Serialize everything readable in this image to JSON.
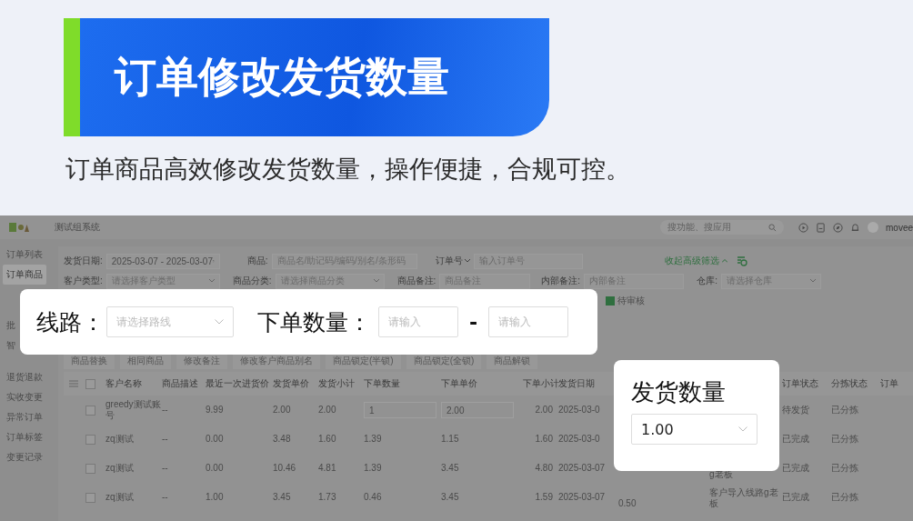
{
  "banner": {
    "title": "订单修改发货数量",
    "subtitle": "订单商品高效修改发货数量，操作便捷，合规可控。"
  },
  "app": {
    "system_name": "测试组系统",
    "search": {
      "placeholder": "搜功能、搜应用"
    },
    "user": "movee",
    "sidebar": {
      "items": [
        {
          "label": "订单列表",
          "selected": false
        },
        {
          "label": "订单商品",
          "selected": true
        },
        {
          "label": "批",
          "selected": false
        },
        {
          "label": "智",
          "selected": false
        },
        {
          "label": "退货退款",
          "selected": false
        },
        {
          "label": "实收变更",
          "selected": false
        },
        {
          "label": "异常订单",
          "selected": false
        },
        {
          "label": "订单标签",
          "selected": false
        },
        {
          "label": "变更记录",
          "selected": false
        }
      ]
    },
    "filters": {
      "row_1": [
        {
          "label": "发货日期:",
          "value": "2025-03-07 - 2025-03-07",
          "kind": "date"
        },
        {
          "label": "商品:",
          "placeholder": "商品名/助记码/编码/别名/条形码",
          "kind": "text"
        },
        {
          "label": "订单号",
          "placeholder": "输入订单号",
          "kind": "dropdown-label"
        }
      ],
      "collapse_link": "收起高级筛选",
      "row_2": [
        {
          "label": "客户类型:",
          "placeholder": "请选择客户类型",
          "kind": "select"
        },
        {
          "label": "商品分类:",
          "placeholder": "请选择商品分类",
          "kind": "select"
        },
        {
          "label": "商品备注:",
          "placeholder": "商品备注",
          "kind": "text"
        },
        {
          "label": "内部备注:",
          "placeholder": "内部备注",
          "kind": "text"
        },
        {
          "label": "仓库:",
          "placeholder": "请选择仓库",
          "kind": "select"
        }
      ],
      "pending_review": {
        "label": "待审核",
        "checked": true
      }
    },
    "actions": [
      "商品替换",
      "相同商品",
      "修改备注",
      "修改客户商品别名",
      "商品锁定(半锁)",
      "商品锁定(全锁)",
      "商品解锁"
    ],
    "table": {
      "all_checked": false,
      "columns": [
        "客户名称",
        "商品描述",
        "最近一次进货价",
        "发货单价",
        "发货小计",
        "下单数量",
        "下单单价",
        "下单小计",
        "发货日期",
        null,
        null,
        "订单状态",
        "分拣状态",
        "订单"
      ],
      "rows": [
        {
          "checked": false,
          "editable": true,
          "cells": [
            "greedy测试账号",
            "--",
            "9.99",
            "2.00",
            "2.00",
            "1",
            "2.00",
            "2.00",
            "2025-03-0",
            null,
            null,
            "待发货",
            "已分拣"
          ]
        },
        {
          "checked": false,
          "editable": false,
          "cells": [
            "zq测试",
            "--",
            "0.00",
            "3.48",
            "1.60",
            "1.39",
            "1.15",
            "1.60",
            "2025-03-0",
            null,
            null,
            "已完成",
            "已分拣"
          ]
        },
        {
          "checked": false,
          "editable": false,
          "cells": [
            "zq测试",
            "--",
            "0.00",
            "10.46",
            "4.81",
            "1.39",
            "3.45",
            "4.80",
            "2025-03-07",
            null,
            "g老板",
            "已完成",
            "已分拣"
          ]
        },
        {
          "checked": false,
          "editable": false,
          "cells": [
            "zq测试",
            "--",
            "1.00",
            "3.45",
            "1.73",
            "0.46",
            "3.45",
            "1.59",
            "2025-03-07",
            "0.50",
            "客户导入线路g老板",
            "已完成",
            "已分拣"
          ]
        }
      ]
    }
  },
  "route_card": {
    "route_label": "线路：",
    "route_placeholder": "请选择路线",
    "qty_label": "下单数量：",
    "min_placeholder": "请输入",
    "separator": "-",
    "max_placeholder": "请输入"
  },
  "ship_card": {
    "label": "发货数量",
    "value": "1.00"
  }
}
